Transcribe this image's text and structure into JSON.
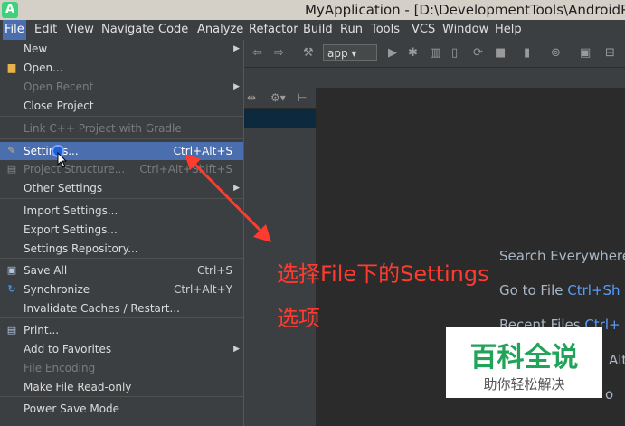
{
  "window": {
    "title": "MyApplication - [D:\\DevelopmentTools\\AndroidP"
  },
  "menubar": [
    "File",
    "Edit",
    "View",
    "Navigate",
    "Code",
    "Analyze",
    "Refactor",
    "Build",
    "Run",
    "Tools",
    "VCS",
    "Window",
    "Help"
  ],
  "toolbar": {
    "run_config": "app"
  },
  "file_menu": [
    {
      "label": "New",
      "shortcut": "",
      "submenu": true,
      "disabled": false,
      "icon": ""
    },
    {
      "label": "Open...",
      "shortcut": "",
      "submenu": false,
      "disabled": false,
      "icon": "folder-icon"
    },
    {
      "label": "Open Recent",
      "shortcut": "",
      "submenu": true,
      "disabled": true,
      "icon": ""
    },
    {
      "label": "Close Project",
      "shortcut": "",
      "submenu": false,
      "disabled": false,
      "icon": ""
    },
    {
      "label": "Link C++ Project with Gradle",
      "shortcut": "",
      "submenu": false,
      "disabled": true,
      "icon": ""
    },
    {
      "label": "Settings...",
      "shortcut": "Ctrl+Alt+S",
      "submenu": false,
      "disabled": false,
      "icon": "wrench-icon",
      "highlight": true
    },
    {
      "label": "Project Structure...",
      "shortcut": "Ctrl+Alt+Shift+S",
      "submenu": false,
      "disabled": true,
      "icon": "structure-icon"
    },
    {
      "label": "Other Settings",
      "shortcut": "",
      "submenu": true,
      "disabled": false,
      "icon": ""
    },
    {
      "label": "Import Settings...",
      "shortcut": "",
      "submenu": false,
      "disabled": false,
      "icon": ""
    },
    {
      "label": "Export Settings...",
      "shortcut": "",
      "submenu": false,
      "disabled": false,
      "icon": ""
    },
    {
      "label": "Settings Repository...",
      "shortcut": "",
      "submenu": false,
      "disabled": false,
      "icon": ""
    },
    {
      "label": "Save All",
      "shortcut": "Ctrl+S",
      "submenu": false,
      "disabled": false,
      "icon": "save-icon"
    },
    {
      "label": "Synchronize",
      "shortcut": "Ctrl+Alt+Y",
      "submenu": false,
      "disabled": false,
      "icon": "sync-icon"
    },
    {
      "label": "Invalidate Caches / Restart...",
      "shortcut": "",
      "submenu": false,
      "disabled": false,
      "icon": ""
    },
    {
      "label": "Print...",
      "shortcut": "",
      "submenu": false,
      "disabled": false,
      "icon": "print-icon"
    },
    {
      "label": "Add to Favorites",
      "shortcut": "",
      "submenu": true,
      "disabled": false,
      "icon": ""
    },
    {
      "label": "File Encoding",
      "shortcut": "",
      "submenu": false,
      "disabled": true,
      "icon": ""
    },
    {
      "label": "Make File Read-only",
      "shortcut": "",
      "submenu": false,
      "disabled": false,
      "icon": ""
    },
    {
      "label": "Power Save Mode",
      "shortcut": "",
      "submenu": false,
      "disabled": false,
      "icon": ""
    }
  ],
  "annotation": {
    "line1": "选择File下的Settings",
    "line2": "选项"
  },
  "welcome": {
    "search": "Search Everywhere",
    "goto": "Go to File",
    "goto_shortcut": "Ctrl+Sh",
    "recent": "Recent Files",
    "recent_shortcut": "Ctrl+",
    "nav_shortcut": "Alt",
    "drop": "o"
  },
  "watermark": {
    "big": "百科全说",
    "small": "助你轻松解决"
  },
  "colors": {
    "highlight": "#4b6eaf",
    "annotation": "#ff3b30",
    "watermark": "#22a35a"
  }
}
